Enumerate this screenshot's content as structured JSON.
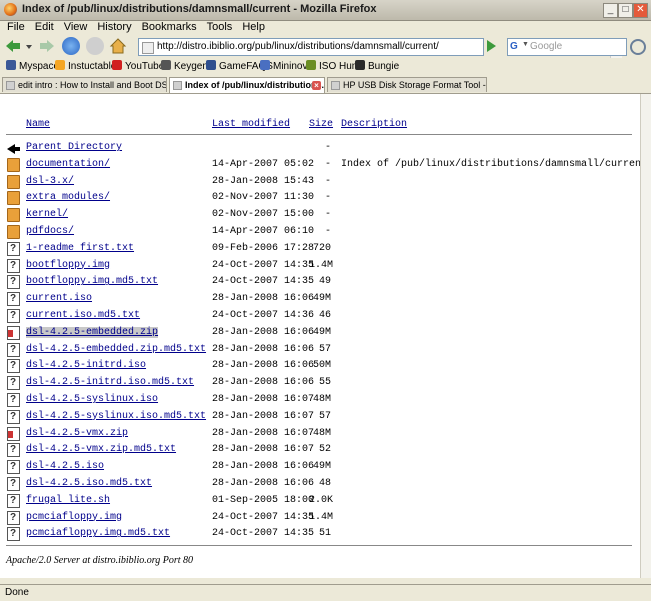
{
  "window": {
    "title": "Index of /pub/linux/distributions/damnsmall/current - Mozilla Firefox",
    "min": "_",
    "max": "□",
    "close": "✕"
  },
  "menu": [
    "File",
    "Edit",
    "View",
    "History",
    "Bookmarks",
    "Tools",
    "Help"
  ],
  "nav": {
    "url": "http://distro.ibiblio.org/pub/linux/distributions/damnsmall/current/",
    "search_placeholder": "Google",
    "search_engine": "G"
  },
  "bookmarks": [
    {
      "label": "Myspace",
      "color": "#3b5998"
    },
    {
      "label": "Instuctables",
      "color": "#f5a623"
    },
    {
      "label": "YouTube",
      "color": "#d12020"
    },
    {
      "label": "Keygens",
      "color": "#555555"
    },
    {
      "label": "GameFAQS",
      "color": "#2f4f8f"
    },
    {
      "label": "Mininova",
      "color": "#4a6fc1"
    },
    {
      "label": "ISO Hunt",
      "color": "#6b8e23"
    },
    {
      "label": "Bungie",
      "color": "#2a2a2a"
    }
  ],
  "tabs": [
    {
      "label": "edit intro : How to Install and Boot DS...",
      "active": false
    },
    {
      "label": "Index of /pub/linux/distributions...",
      "active": true
    },
    {
      "label": "HP USB Disk Storage Format Tool - v2....",
      "active": false
    }
  ],
  "listing": {
    "headers": {
      "name": "Name",
      "modified": "Last modified",
      "size": "Size",
      "desc": "Description"
    },
    "rows": [
      {
        "icon": "back",
        "name": "Parent Directory",
        "modified": "",
        "size": "-",
        "desc": ""
      },
      {
        "icon": "folder",
        "name": "documentation/",
        "modified": "14-Apr-2007 05:02",
        "size": "-",
        "desc": "Index of /pub/linux/distributions/damnsmall/current/docume"
      },
      {
        "icon": "folder",
        "name": "dsl-3.x/",
        "modified": "28-Jan-2008 15:43",
        "size": "-",
        "desc": ""
      },
      {
        "icon": "folder",
        "name": "extra modules/",
        "modified": "02-Nov-2007 11:30",
        "size": "-",
        "desc": ""
      },
      {
        "icon": "folder",
        "name": "kernel/",
        "modified": "02-Nov-2007 15:00",
        "size": "-",
        "desc": ""
      },
      {
        "icon": "folder",
        "name": "pdfdocs/",
        "modified": "14-Apr-2007 06:10",
        "size": "-",
        "desc": ""
      },
      {
        "icon": "file",
        "name": "1-readme first.txt",
        "modified": "09-Feb-2006 17:28",
        "size": "720",
        "desc": ""
      },
      {
        "icon": "file",
        "name": "bootfloppy.img",
        "modified": "24-Oct-2007 14:35",
        "size": "1.4M",
        "desc": ""
      },
      {
        "icon": "file",
        "name": "bootfloppy.img.md5.txt",
        "modified": "24-Oct-2007 14:35",
        "size": "49",
        "desc": ""
      },
      {
        "icon": "file",
        "name": "current.iso",
        "modified": "28-Jan-2008 16:06",
        "size": "49M",
        "desc": ""
      },
      {
        "icon": "file",
        "name": "current.iso.md5.txt",
        "modified": "24-Oct-2007 14:36",
        "size": "46",
        "desc": ""
      },
      {
        "icon": "zip",
        "name": "dsl-4.2.5-embedded.zip",
        "modified": "28-Jan-2008 16:06",
        "size": "49M",
        "desc": "",
        "selected": true
      },
      {
        "icon": "file",
        "name": "dsl-4.2.5-embedded.zip.md5.txt",
        "modified": "28-Jan-2008 16:06",
        "size": "57",
        "desc": ""
      },
      {
        "icon": "file",
        "name": "dsl-4.2.5-initrd.iso",
        "modified": "28-Jan-2008 16:06",
        "size": "50M",
        "desc": ""
      },
      {
        "icon": "file",
        "name": "dsl-4.2.5-initrd.iso.md5.txt",
        "modified": "28-Jan-2008 16:06",
        "size": "55",
        "desc": ""
      },
      {
        "icon": "file",
        "name": "dsl-4.2.5-syslinux.iso",
        "modified": "28-Jan-2008 16:07",
        "size": "48M",
        "desc": ""
      },
      {
        "icon": "file",
        "name": "dsl-4.2.5-syslinux.iso.md5.txt",
        "modified": "28-Jan-2008 16:07",
        "size": "57",
        "desc": ""
      },
      {
        "icon": "zip",
        "name": "dsl-4.2.5-vmx.zip",
        "modified": "28-Jan-2008 16:07",
        "size": "48M",
        "desc": ""
      },
      {
        "icon": "file",
        "name": "dsl-4.2.5-vmx.zip.md5.txt",
        "modified": "28-Jan-2008 16:07",
        "size": "52",
        "desc": ""
      },
      {
        "icon": "file",
        "name": "dsl-4.2.5.iso",
        "modified": "28-Jan-2008 16:06",
        "size": "49M",
        "desc": ""
      },
      {
        "icon": "file",
        "name": "dsl-4.2.5.iso.md5.txt",
        "modified": "28-Jan-2008 16:06",
        "size": "48",
        "desc": ""
      },
      {
        "icon": "file",
        "name": "frugal lite.sh",
        "modified": "01-Sep-2005 18:00",
        "size": "2.0K",
        "desc": ""
      },
      {
        "icon": "file",
        "name": "pcmciafloppy.img",
        "modified": "24-Oct-2007 14:35",
        "size": "1.4M",
        "desc": ""
      },
      {
        "icon": "file",
        "name": "pcmciafloppy.img.md5.txt",
        "modified": "24-Oct-2007 14:35",
        "size": "51",
        "desc": ""
      }
    ],
    "address": "Apache/2.0 Server at distro.ibiblio.org Port 80"
  },
  "status": "Done"
}
